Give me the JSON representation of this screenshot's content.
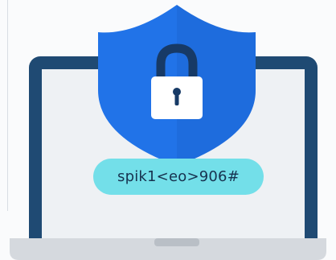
{
  "password": {
    "text": "spik1<eo>906#"
  },
  "colors": {
    "background": "#fafbfc",
    "laptop_frame": "#1f4a73",
    "laptop_screen": "#eef1f4",
    "laptop_base": "#d5d9de",
    "shield": "#2173e8",
    "shield_shadow": "#1a5ec9",
    "lock_body": "#ffffff",
    "lock_shackle": "#173a66",
    "pill": "#73dfe9",
    "password_text": "#17324f"
  },
  "icons": {
    "shield": "shield-icon",
    "lock": "padlock-icon",
    "laptop": "laptop-icon"
  }
}
